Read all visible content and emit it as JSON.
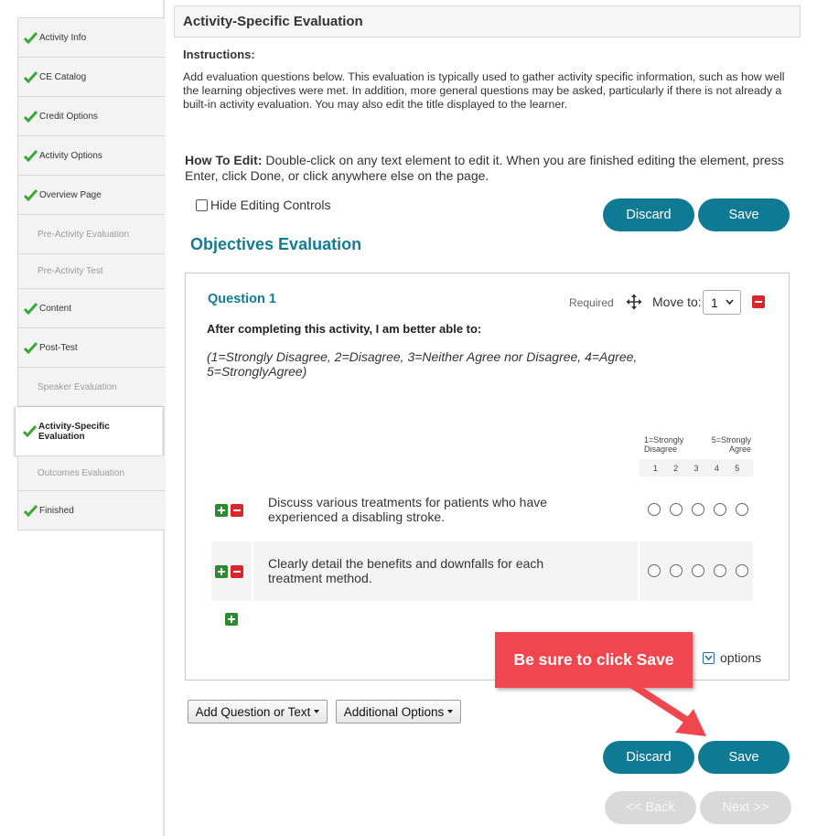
{
  "sidebar": {
    "items": [
      {
        "label": "Activity Info",
        "done": true
      },
      {
        "label": "CE Catalog",
        "done": true
      },
      {
        "label": "Credit Options",
        "done": true
      },
      {
        "label": "Activity Options",
        "done": true
      },
      {
        "label": "Overview Page",
        "done": true
      },
      {
        "label": "Pre-Activity Evaluation",
        "done": false
      },
      {
        "label": "Pre-Activity Test",
        "done": false
      },
      {
        "label": "Content",
        "done": true
      },
      {
        "label": "Post-Test",
        "done": true
      },
      {
        "label": "Speaker Evaluation",
        "done": false
      },
      {
        "label": "Activity-Specific Evaluation",
        "done": true,
        "active": true
      },
      {
        "label": "Outcomes Evaluation",
        "done": false
      },
      {
        "label": "Finished",
        "done": true
      }
    ]
  },
  "header": {
    "title": "Activity-Specific Evaluation"
  },
  "instructions": {
    "title": "Instructions:",
    "text": "Add evaluation questions below. This evaluation is typically used to gather activity specific information, such as how well the learning objectives were met. In addition, more general questions may be asked, particularly if there is not already a built-in activity evaluation. You may also edit the title displayed to the learner."
  },
  "howto": {
    "label": "How To Edit:",
    "text": " Double-click on any text element to edit it. When you are finished editing the element, press Enter, click Done, or click anywhere else on the page."
  },
  "hide_controls_label": "Hide Editing Controls",
  "buttons": {
    "discard": "Discard",
    "save": "Save",
    "back": "<< Back",
    "next": "Next >>",
    "add_question": "Add Question or Text",
    "additional_options": "Additional Options"
  },
  "section_title": "Objectives Evaluation",
  "question": {
    "title": "Question 1",
    "required": "Required",
    "move_to_label": "Move to:",
    "move_to_value": "1",
    "prompt": "After completing this activity, I am better able to:",
    "scale_text": "(1=Strongly Disagree, 2=Disagree, 3=Neither Agree nor Disagree, 4=Agree, 5=StronglyAgree)",
    "scale_left": "1=Strongly\nDisagree",
    "scale_left_1": "1=Strongly",
    "scale_left_2": "Disagree",
    "scale_right_1": "5=Strongly",
    "scale_right_2": "Agree",
    "scale_numbers": [
      "1",
      "2",
      "3",
      "4",
      "5"
    ],
    "items": [
      "Discuss various treatments for patients who have experienced a disabling stroke.",
      "Clearly detail the benefits and downfalls for each treatment method."
    ],
    "options_label": "options"
  },
  "callout": {
    "text": "Be sure to click Save"
  },
  "colors": {
    "accent": "#0e7a94",
    "title_teal": "#127c95",
    "check_green": "#3aa635",
    "remove_red": "#d9262c",
    "add_green": "#2e8a2e",
    "callout_red": "#f0474f"
  }
}
